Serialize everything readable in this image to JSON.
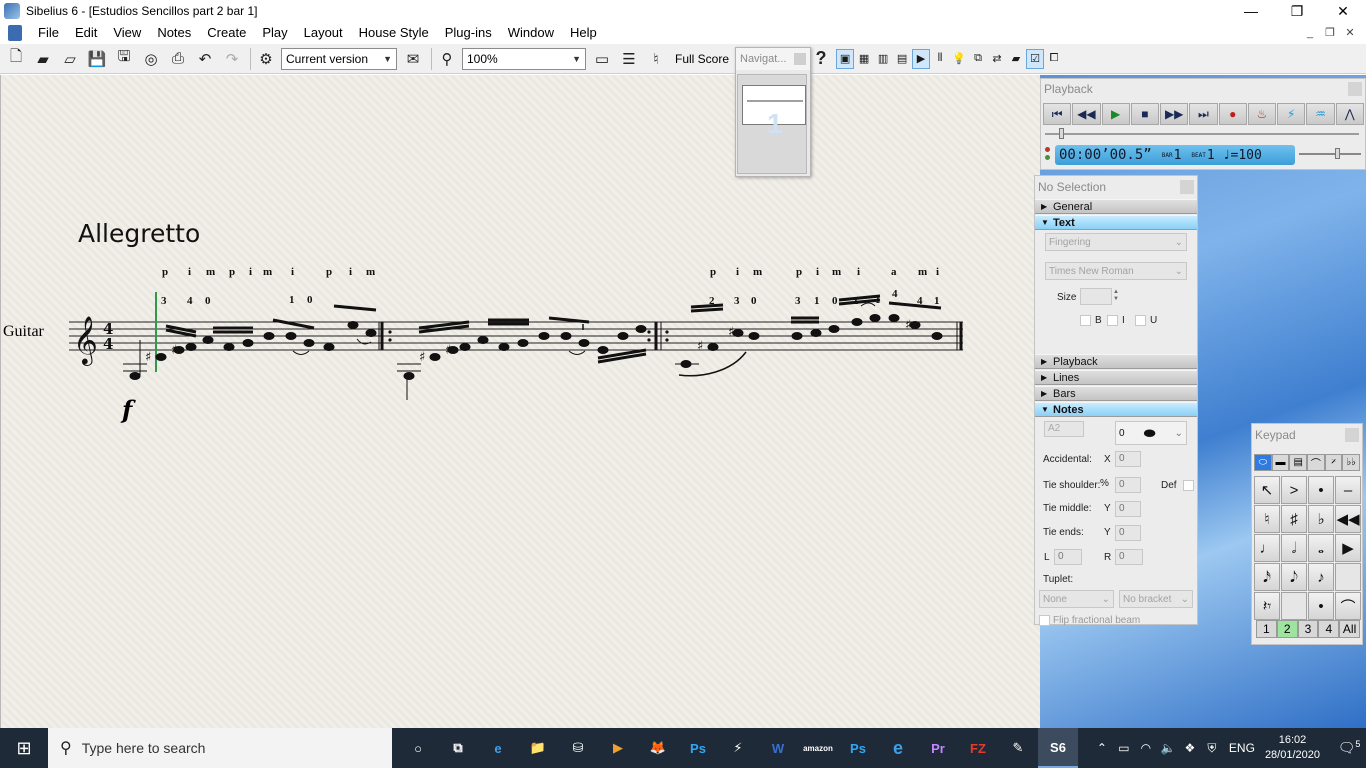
{
  "window": {
    "title": "Sibelius 6 - [Estudios Sencillos part 2 bar 1]",
    "controls": [
      "—",
      "❐",
      "✕"
    ]
  },
  "menu": [
    "File",
    "Edit",
    "View",
    "Notes",
    "Create",
    "Play",
    "Layout",
    "House Style",
    "Plug-ins",
    "Window",
    "Help"
  ],
  "toolbar": {
    "version_combo": "Current version",
    "zoom_combo": "100%",
    "view_label": "Full Score",
    "help_glyph": "?"
  },
  "navigator": {
    "title": "Navigat...",
    "page_number": "1"
  },
  "score": {
    "tempo_text": "Allegretto",
    "instrument_name": "Guitar",
    "time_signature": "4/4",
    "dynamic": "f",
    "fingerings_rh": [
      {
        "text": "p",
        "group": 1
      },
      {
        "text": "i",
        "group": 1
      },
      {
        "text": "m",
        "group": 1
      },
      {
        "text": "p",
        "group": 1
      },
      {
        "text": "i",
        "group": 1
      },
      {
        "text": "m",
        "group": 1
      },
      {
        "text": "i",
        "group": 1
      },
      {
        "text": "p",
        "group": 1
      },
      {
        "text": "i",
        "group": 1
      },
      {
        "text": "m",
        "group": 1
      },
      {
        "text": "p",
        "group": 3
      },
      {
        "text": "i",
        "group": 3
      },
      {
        "text": "m",
        "group": 3
      },
      {
        "text": "p",
        "group": 3
      },
      {
        "text": "i",
        "group": 3
      },
      {
        "text": "m",
        "group": 3
      },
      {
        "text": "i",
        "group": 3
      },
      {
        "text": "a",
        "group": 3
      },
      {
        "text": "m",
        "group": 3
      },
      {
        "text": "i",
        "group": 3
      }
    ],
    "fingerings_lh_bar1": [
      "3",
      "4",
      "0",
      "1",
      "0"
    ],
    "fingerings_lh_bar3": [
      "2",
      "3",
      "0",
      "3",
      "1",
      "0",
      "1",
      "1",
      "4",
      "4",
      "1"
    ]
  },
  "playback": {
    "title": "Playback",
    "time": "00:00’00.5”",
    "bar_label": "BAR",
    "bar_value": "1",
    "beat_label": "BEAT",
    "beat_value": "1",
    "tempo": "♩=100",
    "buttons": [
      "⏮",
      "◀◀",
      "▶",
      "■",
      "▶▶",
      "⏭",
      "●",
      "♨",
      "⚡",
      "♒",
      "⋀"
    ]
  },
  "properties": {
    "title": "No Selection",
    "sections": {
      "general": "General",
      "text": "Text",
      "playback": "Playback",
      "lines": "Lines",
      "bars": "Bars",
      "notes": "Notes"
    },
    "text_style": "Fingering",
    "font": "Times New Roman",
    "size_label": "Size",
    "bold": "B",
    "italic": "I",
    "underline": "U",
    "notes": {
      "note_field": "A2",
      "notehead_value": "0",
      "accidental_label": "Accidental:",
      "x_label": "X",
      "x_value": "0",
      "tie_shoulder_label": "Tie shoulder:",
      "percent_label": "%",
      "tie_shoulder_value": "0",
      "def_label": "Def",
      "tie_middle_label": "Tie middle:",
      "y_label": "Y",
      "tie_middle_value": "0",
      "tie_ends_label": "Tie ends:",
      "tie_ends_value": "0",
      "l_label": "L",
      "l_value": "0",
      "r_label": "R",
      "r_value": "0",
      "tuplet_label": "Tuplet:",
      "tuplet_value": "None",
      "bracket_value": "No bracket",
      "flip_label": "Flip fractional beam"
    }
  },
  "keypad": {
    "title": "Keypad",
    "tabs": [
      "⬭",
      "▬",
      "▤",
      "⌒",
      "𝄎",
      "♭♭"
    ],
    "keys": [
      "↖",
      ">",
      "•",
      "–",
      "♮",
      "♯",
      "♭",
      "◀◀",
      "♩",
      "𝅗𝅥",
      "𝅝",
      "▶",
      "𝅘𝅥𝅯",
      "𝅘𝅥𝅮",
      "♪",
      "",
      "𝄽𝄾",
      "",
      "•",
      "⌒"
    ],
    "layers": [
      "1",
      "2",
      "3",
      "4",
      "All"
    ],
    "active_layer": "2"
  },
  "taskbar": {
    "search_placeholder": "Type here to search",
    "apps": [
      "○",
      "⧉",
      "e",
      "📁",
      "⛁",
      "▶",
      "🦊",
      "Ps",
      "⚡",
      "W",
      "amazon",
      "Ps",
      "e",
      "Pr",
      "FZ",
      "✎",
      "S6"
    ],
    "language": "ENG",
    "time": "16:02",
    "date": "28/01/2020",
    "notifications": "5"
  },
  "colors": {
    "score_paper": "#eeebe4",
    "playback_display": "#4aa8e0",
    "section_open": "#8bd0f6",
    "taskbar": "#1e2a38",
    "active_layer": "#9ee49e"
  }
}
